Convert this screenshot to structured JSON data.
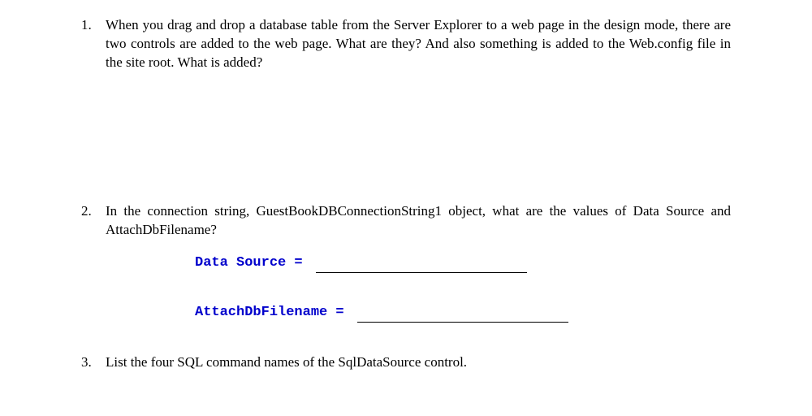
{
  "questions": {
    "q1": "When you drag and drop a database table from the Server Explorer to a web page in the design mode, there are two controls are added to the web page. What are they? And also something is added to the Web.config file in the site root. What is added?",
    "q2": "In the connection string, GuestBookDBConnectionString1 object, what are the values of Data Source and AttachDbFilename?",
    "q3": "List the four SQL command names of the SqlDataSource control."
  },
  "fields": {
    "dataSourceLabel": "Data Source = ",
    "attachLabel": "AttachDbFilename = "
  }
}
